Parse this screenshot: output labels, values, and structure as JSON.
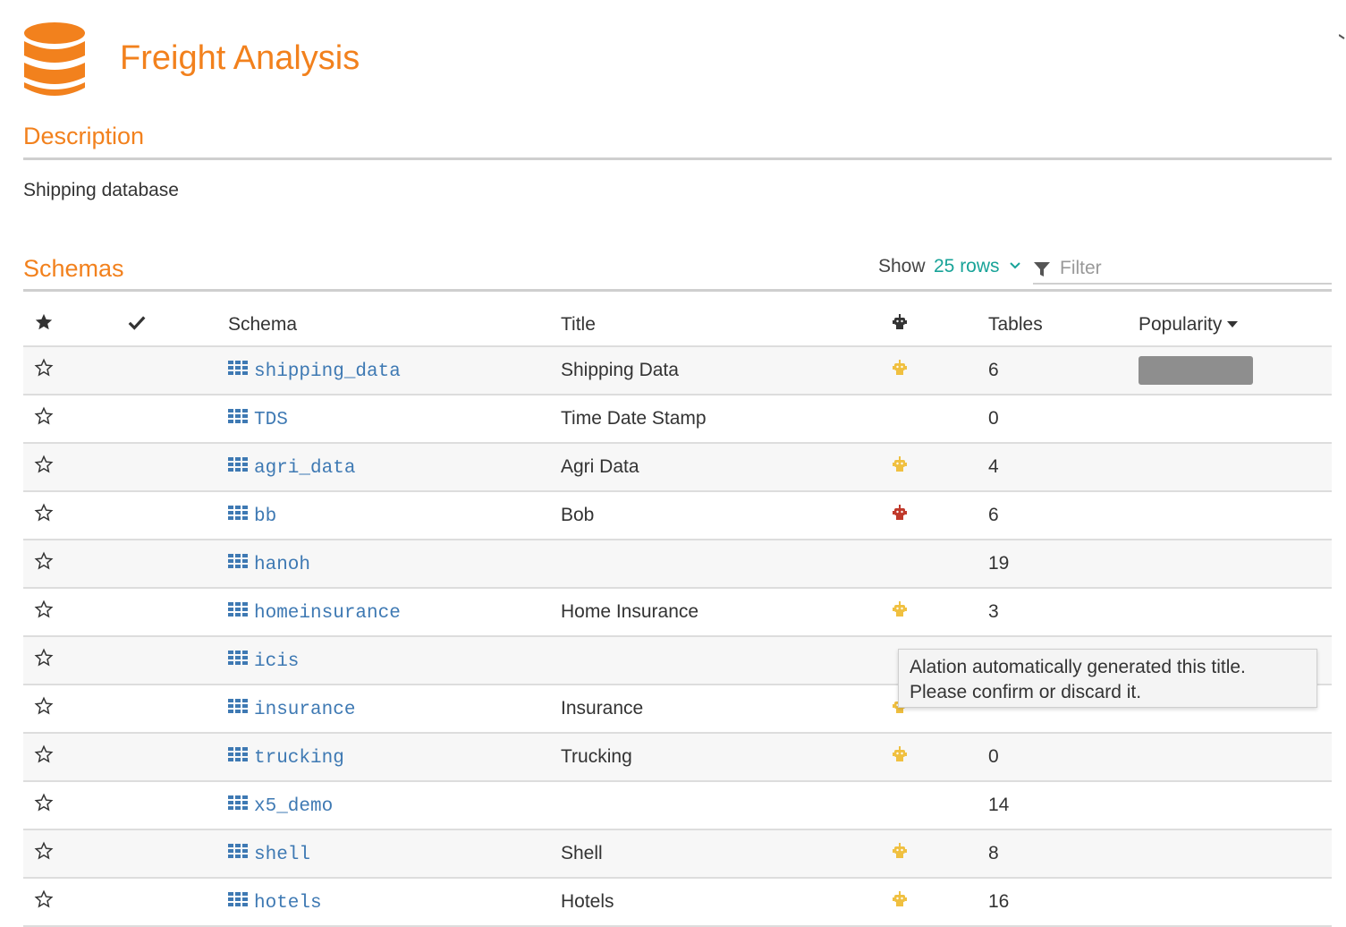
{
  "header": {
    "title": "Freight Analysis",
    "icon": "database-icon",
    "accent_color": "#f2811d"
  },
  "description": {
    "heading": "Description",
    "text": "Shipping database"
  },
  "schemas": {
    "heading": "Schemas",
    "show_label": "Show",
    "rows_option": "25 rows",
    "filter_placeholder": "Filter",
    "columns": {
      "star": "star-icon",
      "check": "check-icon",
      "schema": "Schema",
      "title": "Title",
      "robot": "robot-icon",
      "tables": "Tables",
      "popularity": "Popularity"
    },
    "rows": [
      {
        "name": "shipping_data",
        "title": "Shipping Data",
        "robot": "yellow",
        "tables": "6",
        "popularity": 1.0
      },
      {
        "name": "TDS",
        "title": "Time Date Stamp",
        "robot": "",
        "tables": "0",
        "popularity": 0
      },
      {
        "name": "agri_data",
        "title": "Agri Data",
        "robot": "yellow",
        "tables": "4",
        "popularity": 0
      },
      {
        "name": "bb",
        "title": "Bob",
        "robot": "red",
        "tables": "6",
        "popularity": 0
      },
      {
        "name": "hanoh",
        "title": "",
        "robot": "",
        "tables": "19",
        "popularity": 0
      },
      {
        "name": "homeinsurance",
        "title": "Home Insurance",
        "robot": "yellow",
        "tables": "3",
        "popularity": 0
      },
      {
        "name": "icis",
        "title": "",
        "robot": "",
        "tables": "",
        "popularity": 0
      },
      {
        "name": "insurance",
        "title": "Insurance",
        "robot": "yellow",
        "tables": "",
        "popularity": 0
      },
      {
        "name": "trucking",
        "title": "Trucking",
        "robot": "yellow",
        "tables": "0",
        "popularity": 0
      },
      {
        "name": "x5_demo",
        "title": "",
        "robot": "",
        "tables": "14",
        "popularity": 0
      },
      {
        "name": "shell",
        "title": "Shell",
        "robot": "yellow",
        "tables": "8",
        "popularity": 0
      },
      {
        "name": "hotels",
        "title": "Hotels",
        "robot": "yellow",
        "tables": "16",
        "popularity": 0
      }
    ]
  },
  "tooltip": {
    "line1": "Alation automatically generated this title.",
    "line2": "Please confirm or discard it."
  },
  "colors": {
    "accent": "#f2811d",
    "link": "#3e79b3",
    "teal": "#18a398",
    "robot_yellow": "#f0c040",
    "robot_red": "#c0392b"
  }
}
